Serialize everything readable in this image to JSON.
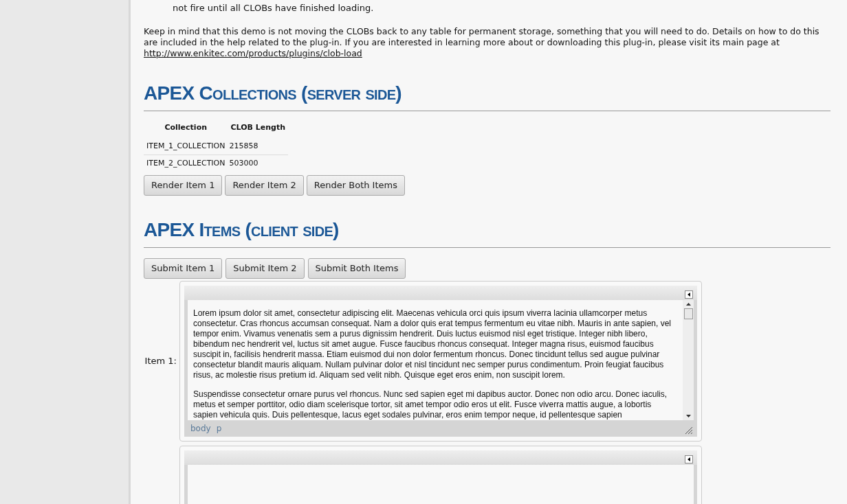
{
  "instructions": {
    "text": "not fire until all CLOBs have finished loading."
  },
  "note": {
    "text": "Keep in mind that this demo is not moving the CLOBs back to any table for permanent storage, something that you will need to do. Details on how to do this are included in the help related to the plug-in. If you are interested in learning more about or downloading this plug-in, please visit its main page at",
    "link": "http://www.enkitec.com/products/plugins/clob-load"
  },
  "collections_section": {
    "title": "APEX Collections (server side)",
    "table": {
      "columns": [
        "Collection",
        "CLOB Length"
      ],
      "rows": [
        [
          "ITEM_1_COLLECTION",
          "215858"
        ],
        [
          "ITEM_2_COLLECTION",
          "503000"
        ]
      ]
    },
    "buttons": [
      "Render Item 1",
      "Render Item 2",
      "Render Both Items"
    ]
  },
  "items_section": {
    "title": "APEX Items (client side)",
    "buttons": [
      "Submit Item 1",
      "Submit Item 2",
      "Submit Both Items"
    ],
    "editors": [
      {
        "kind": "filled",
        "label": "Item 1:",
        "paragraphs": [
          "Lorem ipsum dolor sit amet, consectetur adipiscing elit. Maecenas vehicula orci quis ipsum viverra lacinia ullamcorper metus consectetur. Cras rhoncus accumsan consequat. Nam a dolor quis erat tempus fermentum eu vitae nibh. Mauris in ante sapien, vel tempor enim. Vivamus venenatis sem a purus dignissim hendrerit. Duis luctus euismod nisl eget tristique. Integer nibh libero, bibendum nec hendrerit vel, luctus sit amet augue. Fusce faucibus rhoncus consequat. Integer magna risus, euismod faucibus suscipit in, facilisis hendrerit massa. Etiam euismod dui non dolor fermentum rhoncus. Donec tincidunt tellus sed augue pulvinar consectetur blandit mauris aliquam. Nullam pulvinar dolor et nisl tincidunt nec semper purus condimentum. Proin feugiat faucibus risus, ac molestie risus pretium id. Aliquam sed velit nibh. Quisque eget eros enim, non suscipit lorem.",
          "Suspendisse consectetur ornare purus vel rhoncus. Nunc sed sapien eget mi dapibus auctor. Donec non odio arcu. Donec iaculis, metus et semper porttitor, odio diam scelerisque tortor, sit amet tempor odio eros ut elit. Fusce viverra mattis augue, a lobortis sapien vehicula quis. Duis pellentesque, lacus eget sodales pulvinar, eros enim tempor neque, id pellentesque sapien"
        ],
        "path": [
          "body",
          "p"
        ]
      },
      {
        "kind": "blank"
      }
    ]
  }
}
